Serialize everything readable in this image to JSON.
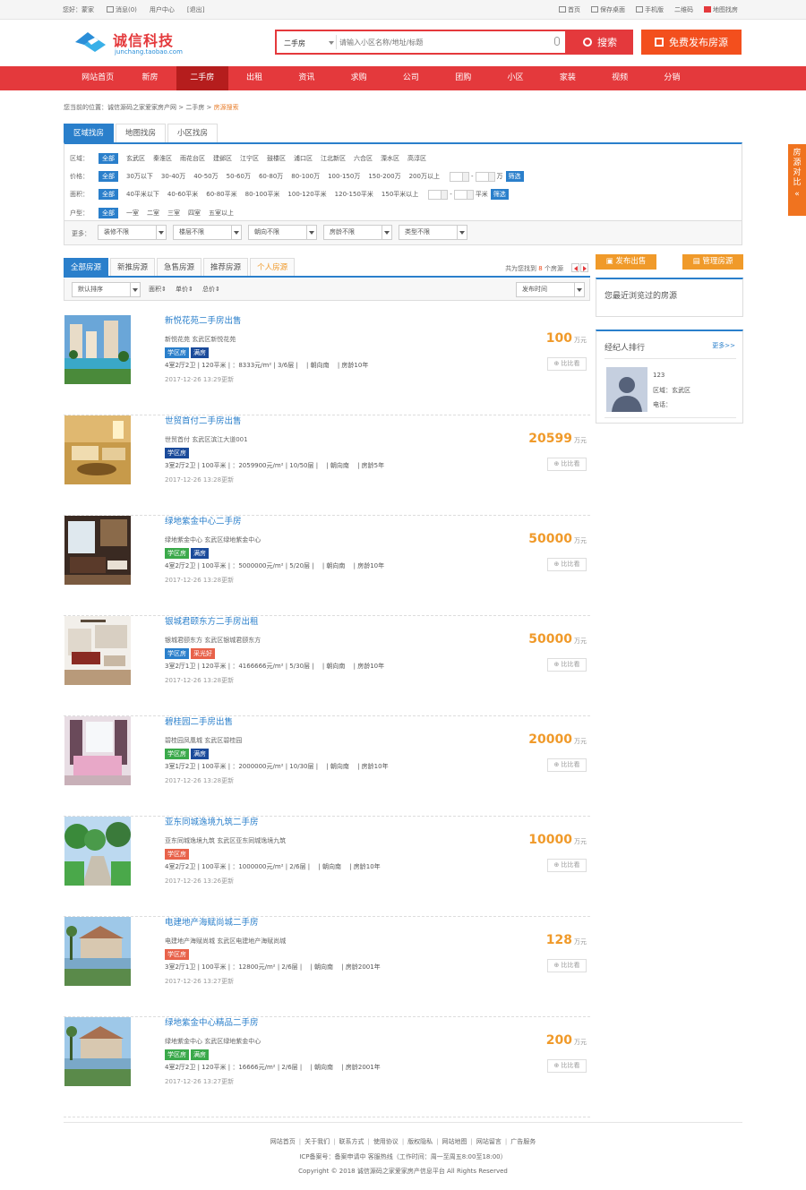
{
  "topbar": {
    "greeting": "您好：蒙家",
    "messages": "消息(0)",
    "user_center": "用户中心",
    "logout": "[退出]",
    "home": "首页",
    "save_desktop": "保存桌面",
    "mobile": "手机版",
    "qrcode": "二维码",
    "map_search": "地图找房"
  },
  "header": {
    "logo_name": "诚信科技",
    "logo_sub": "junchang.taobao.com",
    "search_category": "二手房",
    "search_placeholder": "请输入小区名称/地址/标题",
    "search_button": "搜索",
    "publish_button": "免费发布房源"
  },
  "nav": {
    "items": [
      "网站首页",
      "新房",
      "二手房",
      "出租",
      "资讯",
      "求购",
      "公司",
      "团购",
      "小区",
      "家装",
      "视频",
      "分销"
    ],
    "active_index": 2
  },
  "breadcrumb": {
    "prefix": "您当前的位置：",
    "site": "诚信源码之家爱家房产网",
    "sep1": " > ",
    "section": "二手房",
    "sep2": " > ",
    "current": "房源搜索"
  },
  "finder_tabs": [
    "区域找房",
    "地图找房",
    "小区找房"
  ],
  "filters": {
    "region_label": "区域：",
    "regions": [
      "全部",
      "玄武区",
      "秦淮区",
      "雨花台区",
      "建邺区",
      "江宁区",
      "鼓楼区",
      "浦口区",
      "江北新区",
      "六合区",
      "溧水区",
      "高淳区"
    ],
    "price_label": "价格：",
    "prices": [
      "全部",
      "30万以下",
      "30-40万",
      "40-50万",
      "50-60万",
      "60-80万",
      "80-100万",
      "100-150万",
      "150-200万",
      "200万以上"
    ],
    "price_unit": "万",
    "area_label": "面积：",
    "areas": [
      "全部",
      "40平米以下",
      "40-60平米",
      "60-80平米",
      "80-100平米",
      "100-120平米",
      "120-150平米",
      "150平米以上"
    ],
    "area_unit": "平米",
    "layout_label": "户型：",
    "layouts": [
      "全部",
      "一室",
      "二室",
      "三室",
      "四室",
      "五室以上"
    ],
    "go_label": "筛选",
    "dash": "-",
    "more_label": "更多：",
    "more_selects": [
      "装修不限",
      "楼层不限",
      "朝向不限",
      "房龄不限",
      "类型不限"
    ]
  },
  "list_tabs": {
    "tabs": [
      "全部房源",
      "新推房源",
      "急售房源",
      "推荐房源",
      "个人房源"
    ],
    "count_prefix": "共为您找到 ",
    "count": "8",
    "count_suffix": " 个房源"
  },
  "sortbar": {
    "default_sort": "默认排序",
    "keys": [
      "面积",
      "单价",
      "总价"
    ],
    "publish_time": "发布时间"
  },
  "listings": [
    {
      "title": "新悦花苑二手房出售",
      "addr": "新悦花苑 玄武区新悦花苑",
      "tags": [
        [
          "学区房",
          "xq"
        ],
        [
          "满房",
          "mf"
        ]
      ],
      "info": "4室2厅2卫 | 120平米 | ：8333元/m² | 3/6层 | 　| 朝向南 　| 房龄10年",
      "time": "2017-12-26 13:29更新",
      "price": "100",
      "unit": "万元",
      "compare": "比比看",
      "photo": "resort"
    },
    {
      "title": "世贸首付二手房出售",
      "addr": "世贸首付 玄武区滨江大道001",
      "tags": [
        [
          "学区房",
          "mf"
        ]
      ],
      "info": "3室2厅2卫 | 100平米 | ：2059900元/m² | 10/50层 | 　| 朝向南 　| 房龄5年",
      "time": "2017-12-26 13:28更新",
      "price": "20599",
      "unit": "万元",
      "compare": "比比看",
      "photo": "living"
    },
    {
      "title": "绿地紫金中心二手房",
      "addr": "绿地紫金中心 玄武区绿地紫金中心",
      "tags": [
        [
          "学区房",
          "green"
        ],
        [
          "满房",
          "mf"
        ]
      ],
      "info": "4室2厅2卫 | 100平米 | ：5000000元/m² | 5/20层 | 　| 朝向南 　| 房龄10年",
      "time": "2017-12-26 13:28更新",
      "price": "50000",
      "unit": "万元",
      "compare": "比比看",
      "photo": "room"
    },
    {
      "title": "银城君颐东方二手房出租",
      "addr": "银城君颐东方 玄武区银城君颐东方",
      "tags": [
        [
          "学区房",
          "xq"
        ],
        [
          "采光好",
          "red"
        ]
      ],
      "info": "3室2厅1卫 | 120平米 | ：4166666元/m² | 5/30层 | 　| 朝向南 　| 房龄10年",
      "time": "2017-12-26 13:28更新",
      "price": "50000",
      "unit": "万元",
      "compare": "比比看",
      "photo": "lounge"
    },
    {
      "title": "碧桂园二手房出售",
      "addr": "碧桂园凤凰城 玄武区碧桂园",
      "tags": [
        [
          "学区房",
          "green"
        ],
        [
          "满房",
          "mf"
        ]
      ],
      "info": "3室1厅2卫 | 100平米 | ：2000000元/m² | 10/30层 | 　| 朝向南 　| 房龄10年",
      "time": "2017-12-26 13:28更新",
      "price": "20000",
      "unit": "万元",
      "compare": "比比看",
      "photo": "bedroom"
    },
    {
      "title": "亚东同城逸境九筑二手房",
      "addr": "亚东同城逸境九筑 玄武区亚东同城逸境九筑",
      "tags": [
        [
          "学区房",
          "red"
        ]
      ],
      "info": "4室2厅2卫 | 100平米 | ：1000000元/m² | 2/6层 | 　| 朝向南 　| 房龄10年",
      "time": "2017-12-26 13:26更新",
      "price": "10000",
      "unit": "万元",
      "compare": "比比看",
      "photo": "park"
    },
    {
      "title": "电建地产海赋尚城二手房",
      "addr": "电建地产海赋尚城 玄武区电建地产海赋尚城",
      "tags": [
        [
          "学区房",
          "red"
        ]
      ],
      "info": "3室2厅1卫 | 100平米 | ：12800元/m² | 2/6层 | 　| 朝向南 　| 房龄2001年",
      "time": "2017-12-26 13:27更新",
      "price": "128",
      "unit": "万元",
      "compare": "比比看",
      "photo": "villa"
    },
    {
      "title": "绿地紫金中心精品二手房",
      "addr": "绿地紫金中心 玄武区绿地紫金中心",
      "tags": [
        [
          "学区房",
          "green"
        ],
        [
          "满房",
          "green"
        ]
      ],
      "info": "4室2厅2卫 | 120平米 | ：16666元/m² | 2/6层 | 　| 朝向南 　| 房龄2001年",
      "time": "2017-12-26 13:27更新",
      "price": "200",
      "unit": "万元",
      "compare": "比比看",
      "photo": "villa"
    }
  ],
  "sidebar": {
    "publish_sale": "发布出售",
    "manage": "管理房源",
    "recent_title": "您最近浏览过的房源",
    "agents_title": "经纪人排行",
    "agents_more": "更多>>",
    "agent_name": "123",
    "agent_area": "区域：玄武区",
    "agent_phone": "电话："
  },
  "float_compare": "房源对比",
  "footer": {
    "links": [
      "网站首页",
      "关于我们",
      "联系方式",
      "使用协议",
      "版权隐私",
      "网站地图",
      "网站留言",
      "广告服务"
    ],
    "icp": "ICP备案号：备案申请中 客服热线（工作时间：周一至周五8:00至18:00）",
    "copyright": "Copyright © 2018 诚信源码之家爱家房产信息平台 All Rights Reserved"
  },
  "colors": {
    "brand_red": "#e4393c",
    "nav_active": "#b51d1d",
    "accent_blue": "#2a7fcb",
    "price_orange": "#f09a2a",
    "publish_orange": "#f34f1d"
  }
}
